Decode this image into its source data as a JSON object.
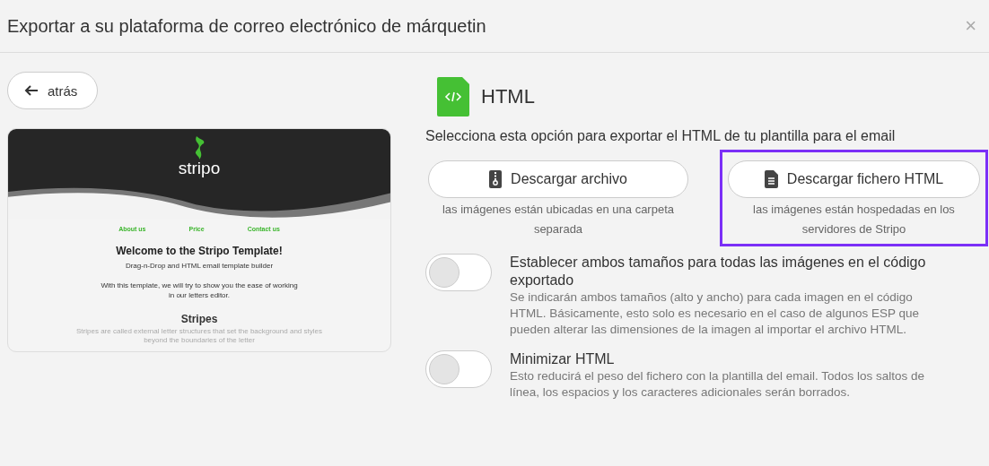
{
  "dialog": {
    "title": "Exportar a su plataforma de correo electrónico de márquetin",
    "close": "×"
  },
  "back_button": {
    "label": "atrás"
  },
  "preview": {
    "logo": "stripo",
    "nav": [
      "About us",
      "Price",
      "Contact us"
    ],
    "heading": "Welcome to the Stripo Template!",
    "subheading": "Drag-n-Drop and HTML email template builder",
    "intro": "With this template, we will try to show you the ease of working in our letters editor.",
    "section_title": "Stripes",
    "section_text": "Stripes are called external letter structures that set the background and styles beyond the boundaries of the letter"
  },
  "format": {
    "name": "HTML",
    "description": "Selecciona esta opción para exportar el HTML de tu plantilla para el email"
  },
  "download_options": [
    {
      "kind": "archive",
      "label": "Descargar archivo",
      "note": "las imágenes están ubicadas en una carpeta separada",
      "highlighted": false
    },
    {
      "kind": "file",
      "label": "Descargar fichero HTML",
      "note": "las imágenes están hospedadas en los servidores de Stripo",
      "highlighted": true
    }
  ],
  "settings": [
    {
      "title": "Establecer ambos tamaños para todas las imágenes en el código exportado",
      "description": "Se indicarán ambos tamaños (alto y ancho) para cada imagen en el código HTML. Básicamente, esto solo es necesario en el caso de algunos ESP que pueden alterar las dimensiones de la imagen al importar el archivo HTML.",
      "on": false
    },
    {
      "title": "Minimizar HTML",
      "description": "Esto reducirá el peso del fichero con la plantilla del email. Todos los saltos de línea, los espacios y los caracteres adicionales serán borrados.",
      "on": false
    }
  ]
}
